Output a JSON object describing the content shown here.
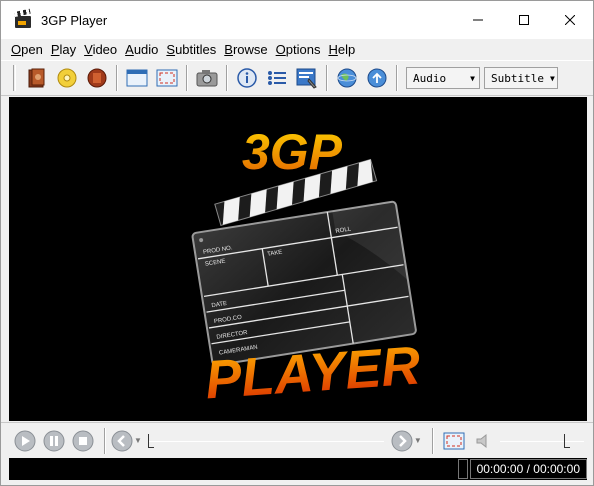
{
  "window": {
    "title": "3GP Player"
  },
  "title_buttons": [
    {
      "name": "minimize-button",
      "glyph": "—"
    },
    {
      "name": "maximize-button",
      "glyph": "☐"
    },
    {
      "name": "close-button",
      "glyph": "✕"
    }
  ],
  "menu": [
    {
      "underline": "O",
      "rest": "pen"
    },
    {
      "underline": "P",
      "rest": "lay"
    },
    {
      "underline": "V",
      "rest": "ideo"
    },
    {
      "underline": "A",
      "rest": "udio"
    },
    {
      "underline": "S",
      "rest": "ubtitles"
    },
    {
      "underline": "B",
      "rest": "rowse"
    },
    {
      "underline": "O",
      "rest": "ptions"
    },
    {
      "underline": "H",
      "rest": "elp"
    }
  ],
  "toolbar": {
    "audio_label": "Audio",
    "subtitle_label": "Subtitle",
    "icons": [
      "open-file-icon",
      "open-disc-icon",
      "open-url-icon",
      "window-icon",
      "fullscreen-icon",
      "screenshot-camera-icon",
      "info-icon",
      "playlist-icon",
      "settings-icon",
      "web-globe-icon",
      "update-globe-icon"
    ]
  },
  "splash": {
    "logo_top": "3GP",
    "logo_bottom": "PLAYER",
    "slate_fields": [
      "PROD NO.",
      "TAKE",
      "ROLL",
      "SCENE",
      "DATE",
      "PROD.CO",
      "DIRECTOR",
      "CAMERAMAN"
    ]
  },
  "controls": {
    "seek_position": 0.0,
    "volume_level": 0.82
  },
  "status": {
    "time": "00:00:00 / 00:00:00"
  },
  "colors": {
    "logo_top": "#f5c000",
    "logo_bottom": "#e23a00",
    "video_bg": "#000000"
  }
}
